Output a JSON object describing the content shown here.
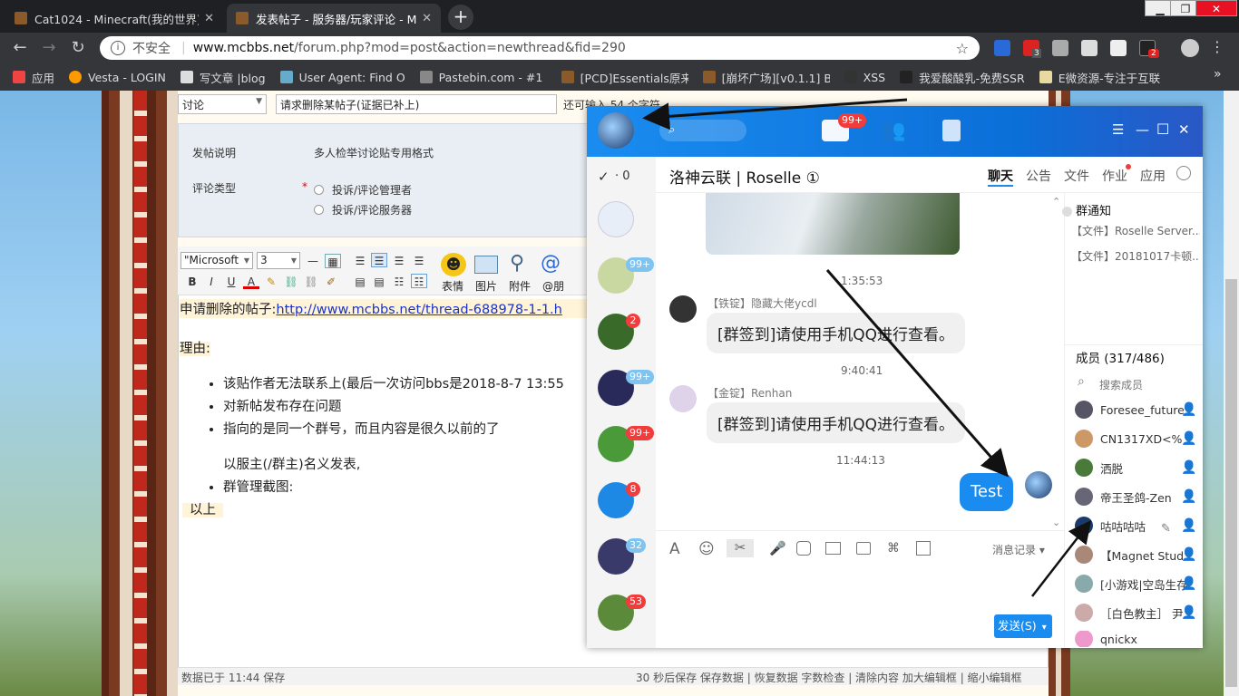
{
  "browser": {
    "tabs": [
      {
        "title": "Cat1024 - Minecraft(我的世界)中",
        "close": "✕"
      },
      {
        "title": "发表帖子 - 服务器/玩家评论 - M",
        "close": "✕"
      }
    ],
    "new_tab": "+",
    "window_controls": {
      "minimize": "▁",
      "restore": "❐",
      "close": "✕"
    },
    "url": {
      "security": "不安全",
      "host": "www.mcbbs.net",
      "path": "/forum.php?mod=post&action=newthread&fid=290"
    },
    "extension_badges": {
      "abp": "3",
      "last": "2"
    },
    "bookmarks": [
      {
        "label": "应用",
        "color": "#e44"
      },
      {
        "label": "Vesta - LOGIN",
        "color": "#f90"
      },
      {
        "label": "写文章 |blog",
        "color": "#ddd"
      },
      {
        "label": "User Agent: Find O",
        "color": "#6ac"
      },
      {
        "label": "Pastebin.com - #1 p",
        "color": "#888"
      },
      {
        "label": "[PCD]Essentials原来",
        "color": "#8b5a2b"
      },
      {
        "label": "[崩坏广场][v0.1.1] Bo",
        "color": "#8b5a2b"
      },
      {
        "label": "XSS",
        "color": "#333"
      },
      {
        "label": "我爱酸酸乳-免费SSR",
        "color": "#222"
      },
      {
        "label": "E微资源-专注于互联",
        "color": "#e8d9a0"
      }
    ],
    "bookmarks_more": "»"
  },
  "form": {
    "category": "讨论",
    "title_value": "请求删除某帖子(证据已补上)",
    "remaining": "还可输入 54 个字符",
    "notice_label": "发帖说明",
    "notice_text": "多人检举讨论贴专用格式",
    "type_label": "评论类型",
    "required_mark": "*",
    "options": [
      "投诉/评论管理者",
      "投诉/评论服务器"
    ]
  },
  "editor": {
    "font": "\"Microsoft",
    "size": "3",
    "tools": {
      "emoji": "表情",
      "image": "图片",
      "attach": "附件",
      "at": "@朋"
    },
    "content": {
      "line1_prefix": "申请删除的帖子:",
      "line1_link": "http://www.mcbbs.net/thread-688978-1-1.h",
      "reason": "理由:",
      "bullets": [
        "该贴作者无法联系上(最后一次访问bbs是2018-8-7 13:55",
        "对新帖发布存在问题",
        "指向的是同一个群号，而且内容是很久以前的了"
      ],
      "indent_line": "以服主(/群主)名义发表,",
      "bullet_last": "群管理截图:",
      "end": "以上"
    },
    "footer_left": "数据已于 11:44 保存",
    "footer_right": "30 秒后保存 保存数据 | 恢复数据    字数检查 | 清除内容    加大编辑框 | 缩小编辑框"
  },
  "qq": {
    "msg_badge": "99+",
    "checked_count": "· 0",
    "window_controls": {
      "menu": "☰",
      "minimize": "—",
      "maximize": "☐",
      "close": "✕"
    },
    "conversations": [
      {
        "badge": "",
        "color": "#e8eef8"
      },
      {
        "badge": "99+",
        "badge_type": "blue",
        "color": "#c9d8a0"
      },
      {
        "badge": "2",
        "badge_type": "red",
        "color": "#3a6a2a"
      },
      {
        "badge": "99+",
        "badge_type": "blue",
        "color": "#2a2a5a"
      },
      {
        "badge": "99+",
        "badge_type": "red",
        "color": "#4a9a3a"
      },
      {
        "badge": "8",
        "badge_type": "red",
        "color": "#1e88e5"
      },
      {
        "badge": "32",
        "badge_type": "blue",
        "color": "#3a3a6a"
      },
      {
        "badge": "53",
        "badge_type": "red",
        "color": "#5a8a3a"
      }
    ],
    "chat_title": "洛神云联 | Roselle ①",
    "chat_tabs": [
      "聊天",
      "公告",
      "文件",
      "作业",
      "应用"
    ],
    "messages": [
      {
        "time": "1:35:53"
      },
      {
        "sender": "【铁锭】隐藏大佬ycdl",
        "text": "[群签到]请使用手机QQ进行查看。",
        "time_after": "9:40:41"
      },
      {
        "sender": "【金锭】Renhan",
        "text": "[群签到]请使用手机QQ进行查看。",
        "time_after": "11:44:13"
      },
      {
        "self_text": "Test"
      }
    ],
    "input_tools": {
      "history": "消息记录 ▾",
      "send": "发送(S)",
      "send_arrow": "▾"
    },
    "notice": {
      "title": "群通知",
      "items": [
        "【文件】Roselle Server...",
        "【文件】20181017卡顿..."
      ]
    },
    "members": {
      "title": "成员 (317/486)",
      "search": "搜索成员",
      "list": [
        {
          "name": "Foresee_future",
          "color": "#556"
        },
        {
          "name": "CN1317XD<%",
          "color": "#c96"
        },
        {
          "name": "洒脱",
          "color": "#4a7a3a"
        },
        {
          "name": "帝王圣鸽-Zen",
          "color": "#667"
        },
        {
          "name": "咕咕咕咕",
          "color": "#1a3a6a"
        },
        {
          "name": "【Magnet Stud",
          "color": "#a87"
        },
        {
          "name": "[小游戏|空岛生存",
          "color": "#8aa"
        },
        {
          "name": "［白色教主］ 尹",
          "color": "#caa"
        },
        {
          "name": "qnickx",
          "color": "#e9c"
        }
      ]
    }
  }
}
